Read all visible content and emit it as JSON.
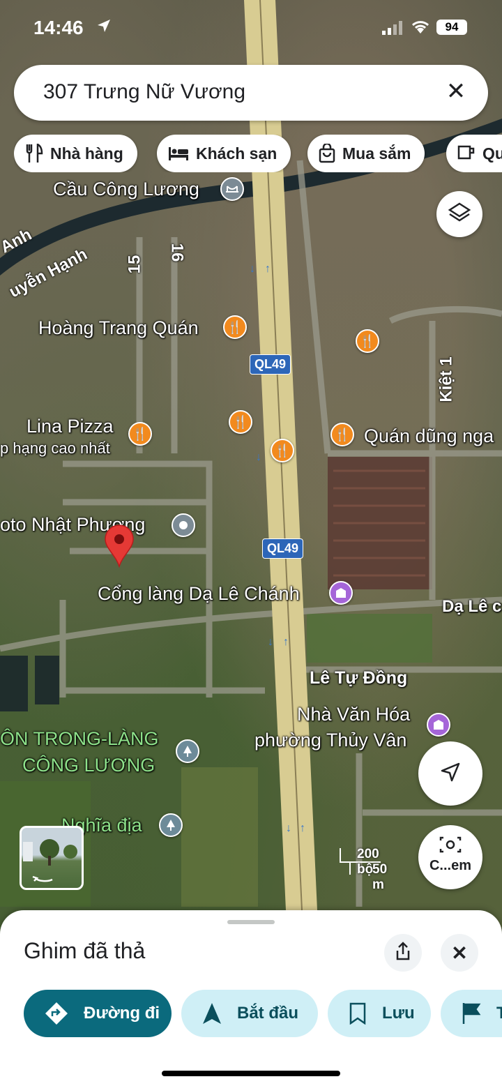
{
  "status_bar": {
    "time": "14:46",
    "battery": "94"
  },
  "search": {
    "query": "307 Trưng Nữ Vương"
  },
  "chips": [
    {
      "label": "Nhà hàng",
      "icon": "restaurant-icon"
    },
    {
      "label": "Khách sạn",
      "icon": "hotel-icon"
    },
    {
      "label": "Mua sắm",
      "icon": "shopping-bag-icon"
    },
    {
      "label": "Qu",
      "icon": "coffee-icon"
    }
  ],
  "map": {
    "places": {
      "cau_cong_luong": "Cầu Công Lương",
      "hoang_trang": "Hoàng Trang Quán",
      "lina_pizza": "Lina Pizza",
      "lina_sub": "p hạng cao nhất",
      "quan_dung": "Quán dũng nga",
      "oto": "oto Nhật Phương",
      "cong_lang": "Cổng làng Dạ Lê Chánh",
      "da_le": "Dạ Lê c",
      "le_tu_dong": "Lê Tự Đồng",
      "nha_van_hoa_1": "Nhà Văn Hóa",
      "nha_van_hoa_2": "phường Thủy Vân",
      "thon_1": "ÔN TRONG-LÀNG",
      "thon_2": "CÔNG LƯƠNG",
      "nghia_dia": "Nghĩa địa"
    },
    "streets": {
      "anh": "Anh",
      "nguyen_hanh": "uyễn Hạnh",
      "s15": "15",
      "s16": "16",
      "kiet1": "Kiệt 1"
    },
    "shields": [
      "QL49",
      "QL49"
    ],
    "scale": {
      "imperial": "200 bộ",
      "metric": "50 m"
    },
    "camera_label": "C...em"
  },
  "sheet": {
    "title": "Ghim đã thả",
    "actions": [
      {
        "label": "Đường đi",
        "icon": "directions-icon"
      },
      {
        "label": "Bắt đầu",
        "icon": "navigation-arrow-icon"
      },
      {
        "label": "Lưu",
        "icon": "bookmark-icon"
      },
      {
        "label": "T",
        "icon": "flag-icon"
      }
    ]
  },
  "colors": {
    "primary": "#0b6a7d",
    "secondary": "#cfeff6",
    "food_poi": "#f28a1e",
    "highway": "#d8cc92"
  }
}
